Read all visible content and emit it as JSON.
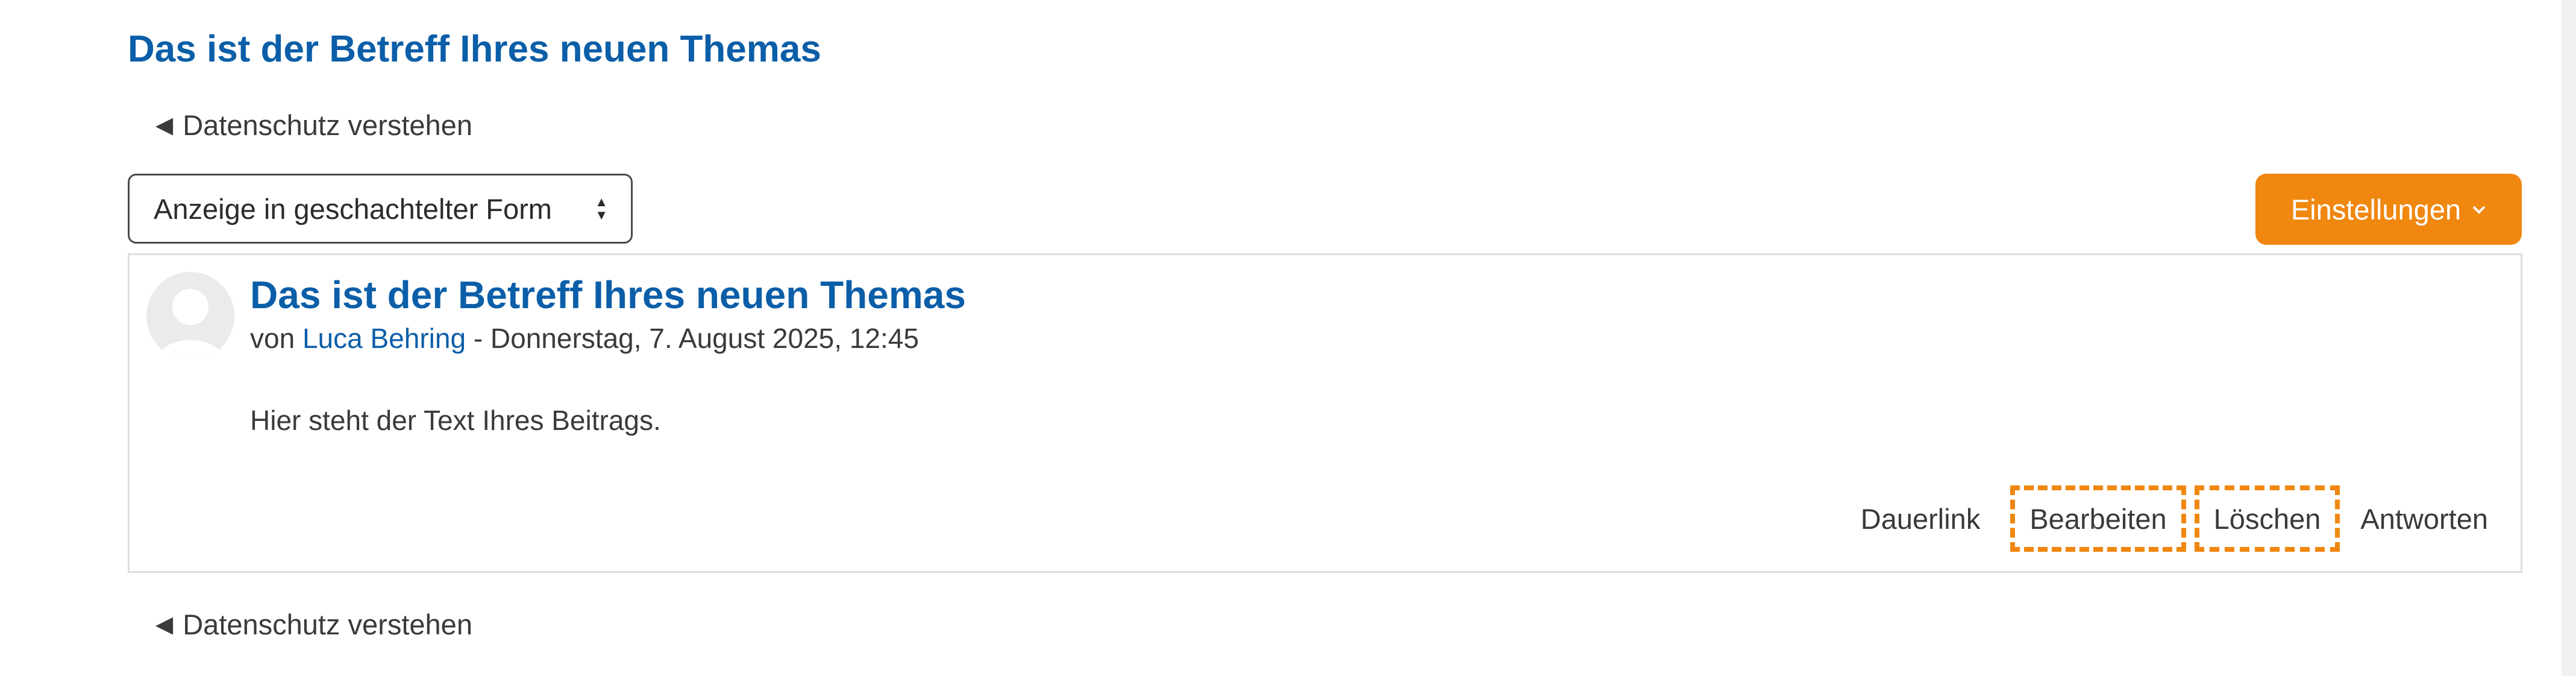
{
  "discussion": {
    "title": "Das ist der Betreff Ihres neuen Themas"
  },
  "navigation": {
    "top_link": "Datenschutz verstehen",
    "bottom_link": "Datenschutz verstehen"
  },
  "toolbar": {
    "display_mode": "Anzeige in geschachtelter Form",
    "settings_label": "Einstellungen"
  },
  "post": {
    "subject": "Das ist der Betreff Ihres neuen Themas",
    "by_prefix": "von",
    "author": "Luca Behring",
    "date_text": " - Donnerstag, 7. August 2025, 12:45",
    "body": "Hier steht der Text Ihres Beitrags.",
    "actions": {
      "permalink": "Dauerlink",
      "edit": "Bearbeiten",
      "delete": "Löschen",
      "reply": "Antworten"
    }
  },
  "colors": {
    "heading_blue": "#0b5ea8",
    "accent_orange": "#f0870f",
    "text_gray": "#3a3a3a",
    "border_gray": "#dedede"
  },
  "icons": {
    "nav_back": "triangle-left-icon",
    "select_arrows": "sort-arrows-icon",
    "settings_chevron": "chevron-down-icon",
    "avatar": "user-avatar-icon"
  }
}
